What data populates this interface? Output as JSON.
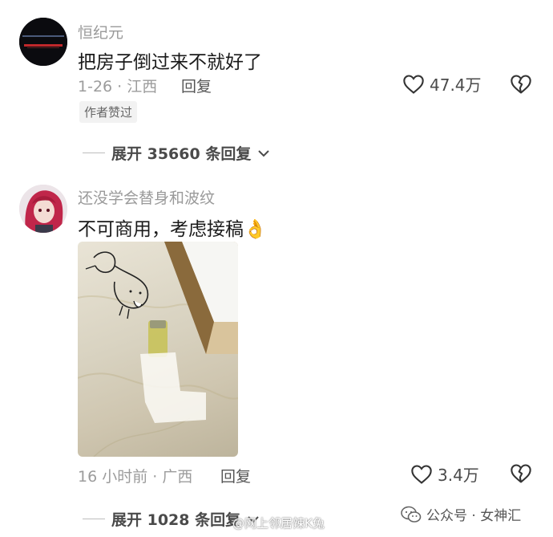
{
  "comments": [
    {
      "username": "恒纪元",
      "content": "把房子倒过来不就好了",
      "meta": "1-26 · 江西",
      "reply_label": "回复",
      "likes": "47.4万",
      "badge": "作者赞过",
      "expand_label": "展开 35660 条回复"
    },
    {
      "username": "还没学会替身和波纹",
      "content": "不可商用，考虑接稿",
      "emoji": "👌",
      "meta": "16 小时前 · 广西",
      "reply_label": "回复",
      "likes": "3.4万",
      "expand_label": "展开 1028 条回复"
    }
  ],
  "watermark": {
    "text": "公众号 · 女神汇",
    "weibo": "@网上邻居辣K兔"
  },
  "icons": {
    "like": "heart-outline-icon",
    "dislike": "broken-heart-icon",
    "expand": "chevron-down-icon",
    "wechat": "wechat-icon"
  },
  "colors": {
    "username": "#9a9a9a",
    "meta": "#9c9c9c",
    "text": "#1a1a1a"
  }
}
